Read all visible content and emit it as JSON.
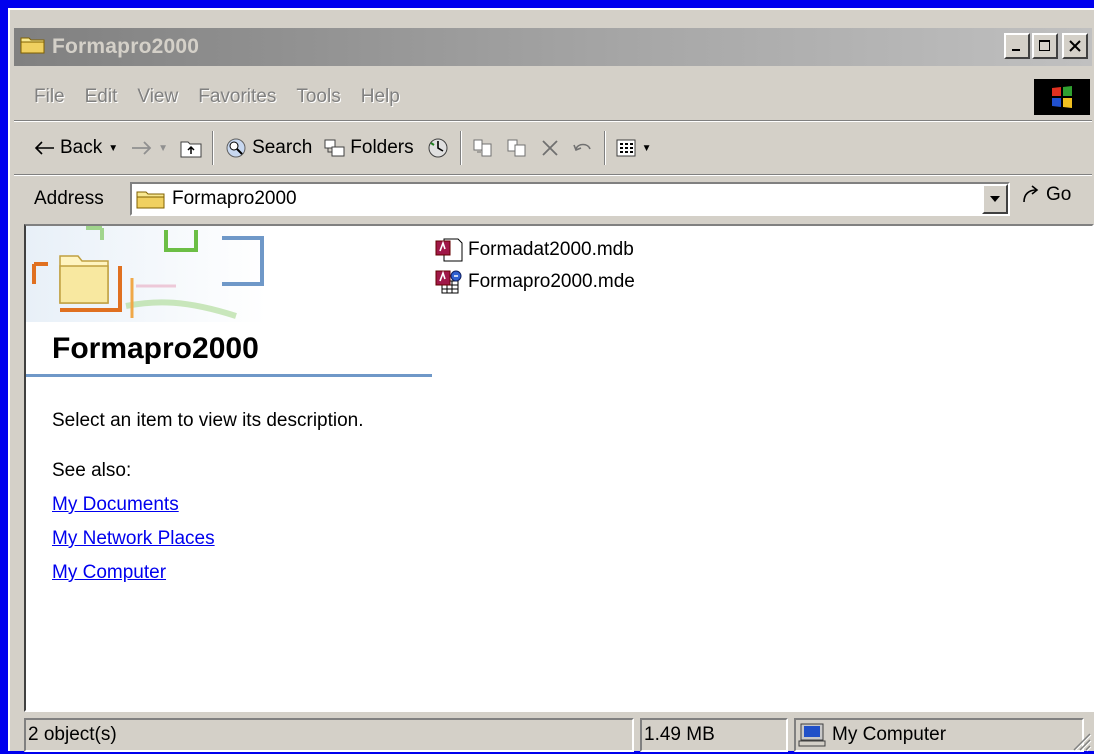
{
  "window": {
    "title": "Formapro2000"
  },
  "menu": [
    "File",
    "Edit",
    "View",
    "Favorites",
    "Tools",
    "Help"
  ],
  "toolbar": {
    "back_label": "Back",
    "search_label": "Search",
    "folders_label": "Folders"
  },
  "address": {
    "label": "Address",
    "value": "Formapro2000",
    "go_label": "Go"
  },
  "left_pane": {
    "title": "Formapro2000",
    "description": "Select an item to view its description.",
    "see_also_label": "See also:",
    "links": [
      "My Documents",
      "My Network Places",
      "My Computer"
    ]
  },
  "files": [
    {
      "name": "Formadat2000.mdb",
      "icon": "access-database-icon"
    },
    {
      "name": "Formapro2000.mde",
      "icon": "access-mde-icon"
    }
  ],
  "status": {
    "objects": "2 object(s)",
    "size": "1.49 MB",
    "location": "My Computer"
  },
  "colors": {
    "desktop": "#0000ee",
    "chrome": "#d4d0c8",
    "link": "#0000ee",
    "pane_rule": "#6f98c8"
  }
}
